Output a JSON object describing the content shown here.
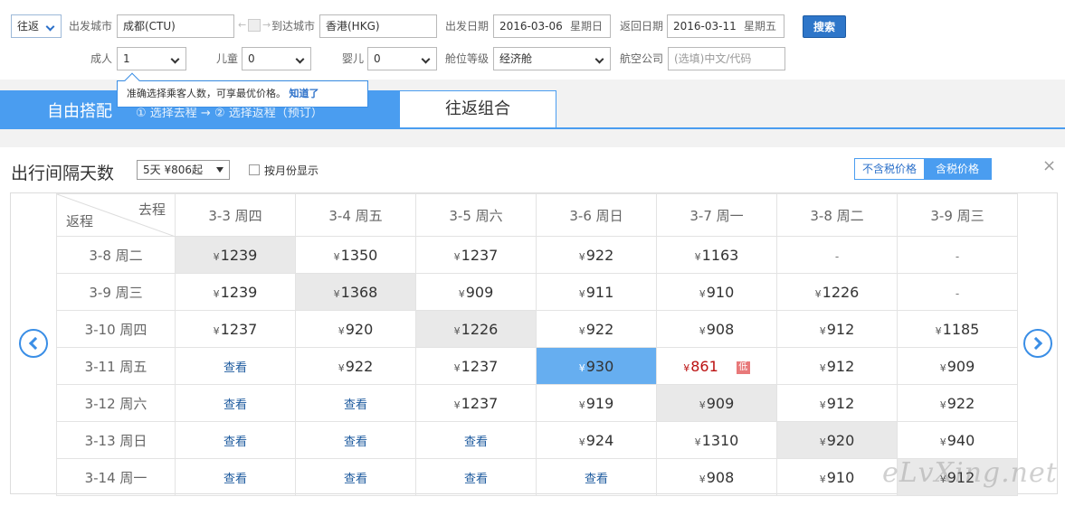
{
  "search": {
    "trip_type": "往返",
    "from_label": "出发城市",
    "from_value": "成都(CTU)",
    "to_label": "到达城市",
    "to_value": "香港(HKG)",
    "depart_label": "出发日期",
    "depart_date": "2016-03-06",
    "depart_weekday": "星期日",
    "return_label": "返回日期",
    "return_date": "2016-03-11",
    "return_weekday": "星期五",
    "search_button": "搜索",
    "adult_label": "成人",
    "adult_value": "1",
    "child_label": "儿童",
    "child_value": "0",
    "infant_label": "婴儿",
    "infant_value": "0",
    "cabin_label": "舱位等级",
    "cabin_value": "经济舱",
    "airline_label": "航空公司",
    "airline_placeholder": "(选填)中文/代码"
  },
  "tooltip": {
    "text": "准确选择乘客人数，可享最优价格。",
    "got_it": "知道了"
  },
  "tabs": {
    "free_title": "自由搭配",
    "free_steps": "① 选择去程 → ② 选择返程（预订）",
    "combo_title": "往返组合"
  },
  "panel": {
    "title": "出行间隔天数",
    "gap_select": "5天 ¥806起",
    "monthly_label": "按月份显示",
    "tax_excluded": "不含税价格",
    "tax_included": "含税价格",
    "close_symbol": "×"
  },
  "calendar": {
    "corner_out": "去程",
    "corner_return": "返程",
    "columns": [
      "3-3 周四",
      "3-4 周五",
      "3-5 周六",
      "3-6 周日",
      "3-7 周一",
      "3-8 周二",
      "3-9 周三"
    ],
    "rows": [
      {
        "label": "3-8 周二",
        "cells": [
          "1239",
          "1350",
          "1237",
          "922",
          "1163",
          "-",
          "-"
        ]
      },
      {
        "label": "3-9 周三",
        "cells": [
          "1239",
          "1368",
          "909",
          "911",
          "910",
          "1226",
          "-"
        ]
      },
      {
        "label": "3-10 周四",
        "cells": [
          "1237",
          "920",
          "1226",
          "922",
          "908",
          "912",
          "1185"
        ]
      },
      {
        "label": "3-11 周五",
        "cells": [
          "查看",
          "922",
          "1237",
          "930",
          "861",
          "912",
          "909"
        ]
      },
      {
        "label": "3-12 周六",
        "cells": [
          "查看",
          "查看",
          "1237",
          "919",
          "909",
          "912",
          "922"
        ]
      },
      {
        "label": "3-13 周日",
        "cells": [
          "查看",
          "查看",
          "查看",
          "924",
          "1310",
          "920",
          "940"
        ]
      },
      {
        "label": "3-14 周一",
        "cells": [
          "查看",
          "查看",
          "查看",
          "查看",
          "908",
          "910",
          "912"
        ]
      }
    ],
    "currency": "¥",
    "low_tag": "低",
    "low_cell": [
      3,
      4
    ],
    "selected_cell": [
      3,
      3
    ]
  },
  "watermark": "eLvXing.net"
}
